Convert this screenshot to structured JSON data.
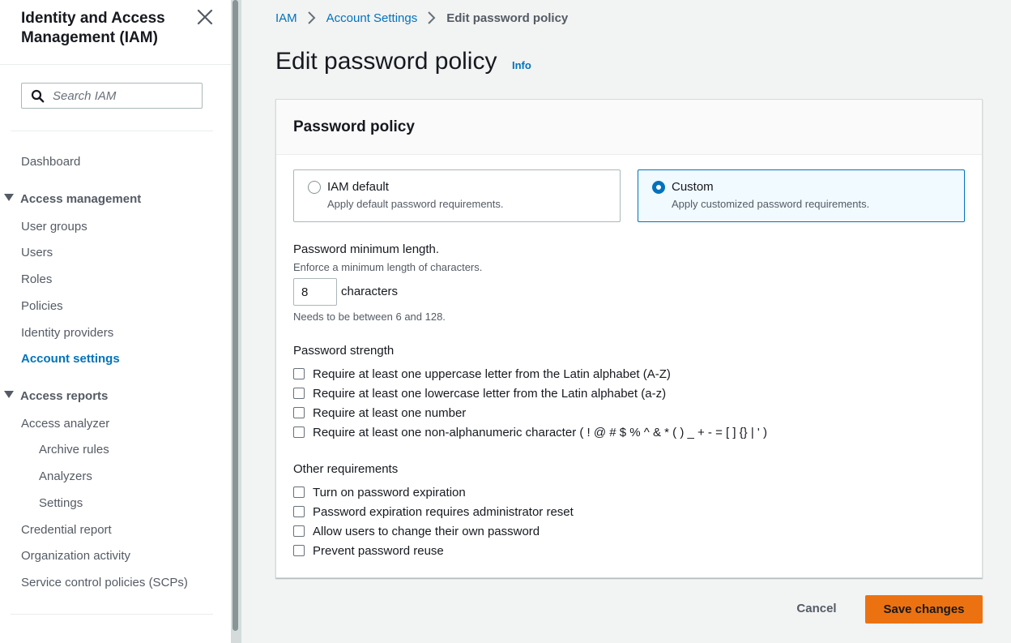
{
  "sidebar": {
    "title": "Identity and Access Management (IAM)",
    "search_placeholder": "Search IAM",
    "dashboard": "Dashboard",
    "access_management": {
      "label": "Access management",
      "items": [
        "User groups",
        "Users",
        "Roles",
        "Policies",
        "Identity providers",
        "Account settings"
      ]
    },
    "access_reports": {
      "label": "Access reports",
      "access_analyzer": "Access analyzer",
      "analyzer_items": [
        "Archive rules",
        "Analyzers",
        "Settings"
      ],
      "items": [
        "Credential report",
        "Organization activity",
        "Service control policies (SCPs)"
      ]
    },
    "active_item": "Account settings"
  },
  "breadcrumb": {
    "items": [
      "IAM",
      "Account Settings"
    ],
    "current": "Edit password policy"
  },
  "page": {
    "title": "Edit password policy",
    "info_link": "Info"
  },
  "card": {
    "title": "Password policy",
    "options": [
      {
        "label": "IAM default",
        "description": "Apply default password requirements.",
        "selected": false
      },
      {
        "label": "Custom",
        "description": "Apply customized password requirements.",
        "selected": true
      }
    ],
    "min_length": {
      "label": "Password minimum length.",
      "description": "Enforce a minimum length of characters.",
      "value": "8",
      "suffix": "characters",
      "hint": "Needs to be between 6 and 128."
    },
    "strength": {
      "label": "Password strength",
      "items": [
        "Require at least one uppercase letter from the Latin alphabet (A-Z)",
        "Require at least one lowercase letter from the Latin alphabet (a-z)",
        "Require at least one number",
        "Require at least one non-alphanumeric character ( ! @ # $ % ^ & * ( ) _ + - = [ ] {} | ' )"
      ]
    },
    "other": {
      "label": "Other requirements",
      "items": [
        "Turn on password expiration",
        "Password expiration requires administrator reset",
        "Allow users to change their own password",
        "Prevent password reuse"
      ]
    }
  },
  "actions": {
    "cancel": "Cancel",
    "save": "Save changes"
  },
  "colors": {
    "link": "#0073bb",
    "primary_button": "#ec7211",
    "selected_tile_bg": "#f1faff"
  }
}
